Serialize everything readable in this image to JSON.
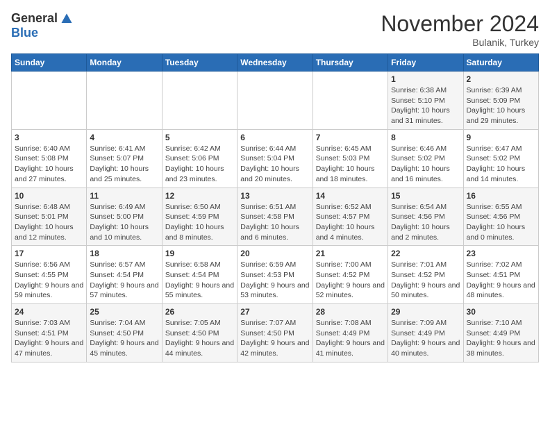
{
  "logo": {
    "general": "General",
    "blue": "Blue"
  },
  "title": "November 2024",
  "location": "Bulanik, Turkey",
  "days_of_week": [
    "Sunday",
    "Monday",
    "Tuesday",
    "Wednesday",
    "Thursday",
    "Friday",
    "Saturday"
  ],
  "weeks": [
    [
      {
        "day": "",
        "info": ""
      },
      {
        "day": "",
        "info": ""
      },
      {
        "day": "",
        "info": ""
      },
      {
        "day": "",
        "info": ""
      },
      {
        "day": "",
        "info": ""
      },
      {
        "day": "1",
        "info": "Sunrise: 6:38 AM\nSunset: 5:10 PM\nDaylight: 10 hours and 31 minutes."
      },
      {
        "day": "2",
        "info": "Sunrise: 6:39 AM\nSunset: 5:09 PM\nDaylight: 10 hours and 29 minutes."
      }
    ],
    [
      {
        "day": "3",
        "info": "Sunrise: 6:40 AM\nSunset: 5:08 PM\nDaylight: 10 hours and 27 minutes."
      },
      {
        "day": "4",
        "info": "Sunrise: 6:41 AM\nSunset: 5:07 PM\nDaylight: 10 hours and 25 minutes."
      },
      {
        "day": "5",
        "info": "Sunrise: 6:42 AM\nSunset: 5:06 PM\nDaylight: 10 hours and 23 minutes."
      },
      {
        "day": "6",
        "info": "Sunrise: 6:44 AM\nSunset: 5:04 PM\nDaylight: 10 hours and 20 minutes."
      },
      {
        "day": "7",
        "info": "Sunrise: 6:45 AM\nSunset: 5:03 PM\nDaylight: 10 hours and 18 minutes."
      },
      {
        "day": "8",
        "info": "Sunrise: 6:46 AM\nSunset: 5:02 PM\nDaylight: 10 hours and 16 minutes."
      },
      {
        "day": "9",
        "info": "Sunrise: 6:47 AM\nSunset: 5:02 PM\nDaylight: 10 hours and 14 minutes."
      }
    ],
    [
      {
        "day": "10",
        "info": "Sunrise: 6:48 AM\nSunset: 5:01 PM\nDaylight: 10 hours and 12 minutes."
      },
      {
        "day": "11",
        "info": "Sunrise: 6:49 AM\nSunset: 5:00 PM\nDaylight: 10 hours and 10 minutes."
      },
      {
        "day": "12",
        "info": "Sunrise: 6:50 AM\nSunset: 4:59 PM\nDaylight: 10 hours and 8 minutes."
      },
      {
        "day": "13",
        "info": "Sunrise: 6:51 AM\nSunset: 4:58 PM\nDaylight: 10 hours and 6 minutes."
      },
      {
        "day": "14",
        "info": "Sunrise: 6:52 AM\nSunset: 4:57 PM\nDaylight: 10 hours and 4 minutes."
      },
      {
        "day": "15",
        "info": "Sunrise: 6:54 AM\nSunset: 4:56 PM\nDaylight: 10 hours and 2 minutes."
      },
      {
        "day": "16",
        "info": "Sunrise: 6:55 AM\nSunset: 4:56 PM\nDaylight: 10 hours and 0 minutes."
      }
    ],
    [
      {
        "day": "17",
        "info": "Sunrise: 6:56 AM\nSunset: 4:55 PM\nDaylight: 9 hours and 59 minutes."
      },
      {
        "day": "18",
        "info": "Sunrise: 6:57 AM\nSunset: 4:54 PM\nDaylight: 9 hours and 57 minutes."
      },
      {
        "day": "19",
        "info": "Sunrise: 6:58 AM\nSunset: 4:54 PM\nDaylight: 9 hours and 55 minutes."
      },
      {
        "day": "20",
        "info": "Sunrise: 6:59 AM\nSunset: 4:53 PM\nDaylight: 9 hours and 53 minutes."
      },
      {
        "day": "21",
        "info": "Sunrise: 7:00 AM\nSunset: 4:52 PM\nDaylight: 9 hours and 52 minutes."
      },
      {
        "day": "22",
        "info": "Sunrise: 7:01 AM\nSunset: 4:52 PM\nDaylight: 9 hours and 50 minutes."
      },
      {
        "day": "23",
        "info": "Sunrise: 7:02 AM\nSunset: 4:51 PM\nDaylight: 9 hours and 48 minutes."
      }
    ],
    [
      {
        "day": "24",
        "info": "Sunrise: 7:03 AM\nSunset: 4:51 PM\nDaylight: 9 hours and 47 minutes."
      },
      {
        "day": "25",
        "info": "Sunrise: 7:04 AM\nSunset: 4:50 PM\nDaylight: 9 hours and 45 minutes."
      },
      {
        "day": "26",
        "info": "Sunrise: 7:05 AM\nSunset: 4:50 PM\nDaylight: 9 hours and 44 minutes."
      },
      {
        "day": "27",
        "info": "Sunrise: 7:07 AM\nSunset: 4:50 PM\nDaylight: 9 hours and 42 minutes."
      },
      {
        "day": "28",
        "info": "Sunrise: 7:08 AM\nSunset: 4:49 PM\nDaylight: 9 hours and 41 minutes."
      },
      {
        "day": "29",
        "info": "Sunrise: 7:09 AM\nSunset: 4:49 PM\nDaylight: 9 hours and 40 minutes."
      },
      {
        "day": "30",
        "info": "Sunrise: 7:10 AM\nSunset: 4:49 PM\nDaylight: 9 hours and 38 minutes."
      }
    ]
  ]
}
